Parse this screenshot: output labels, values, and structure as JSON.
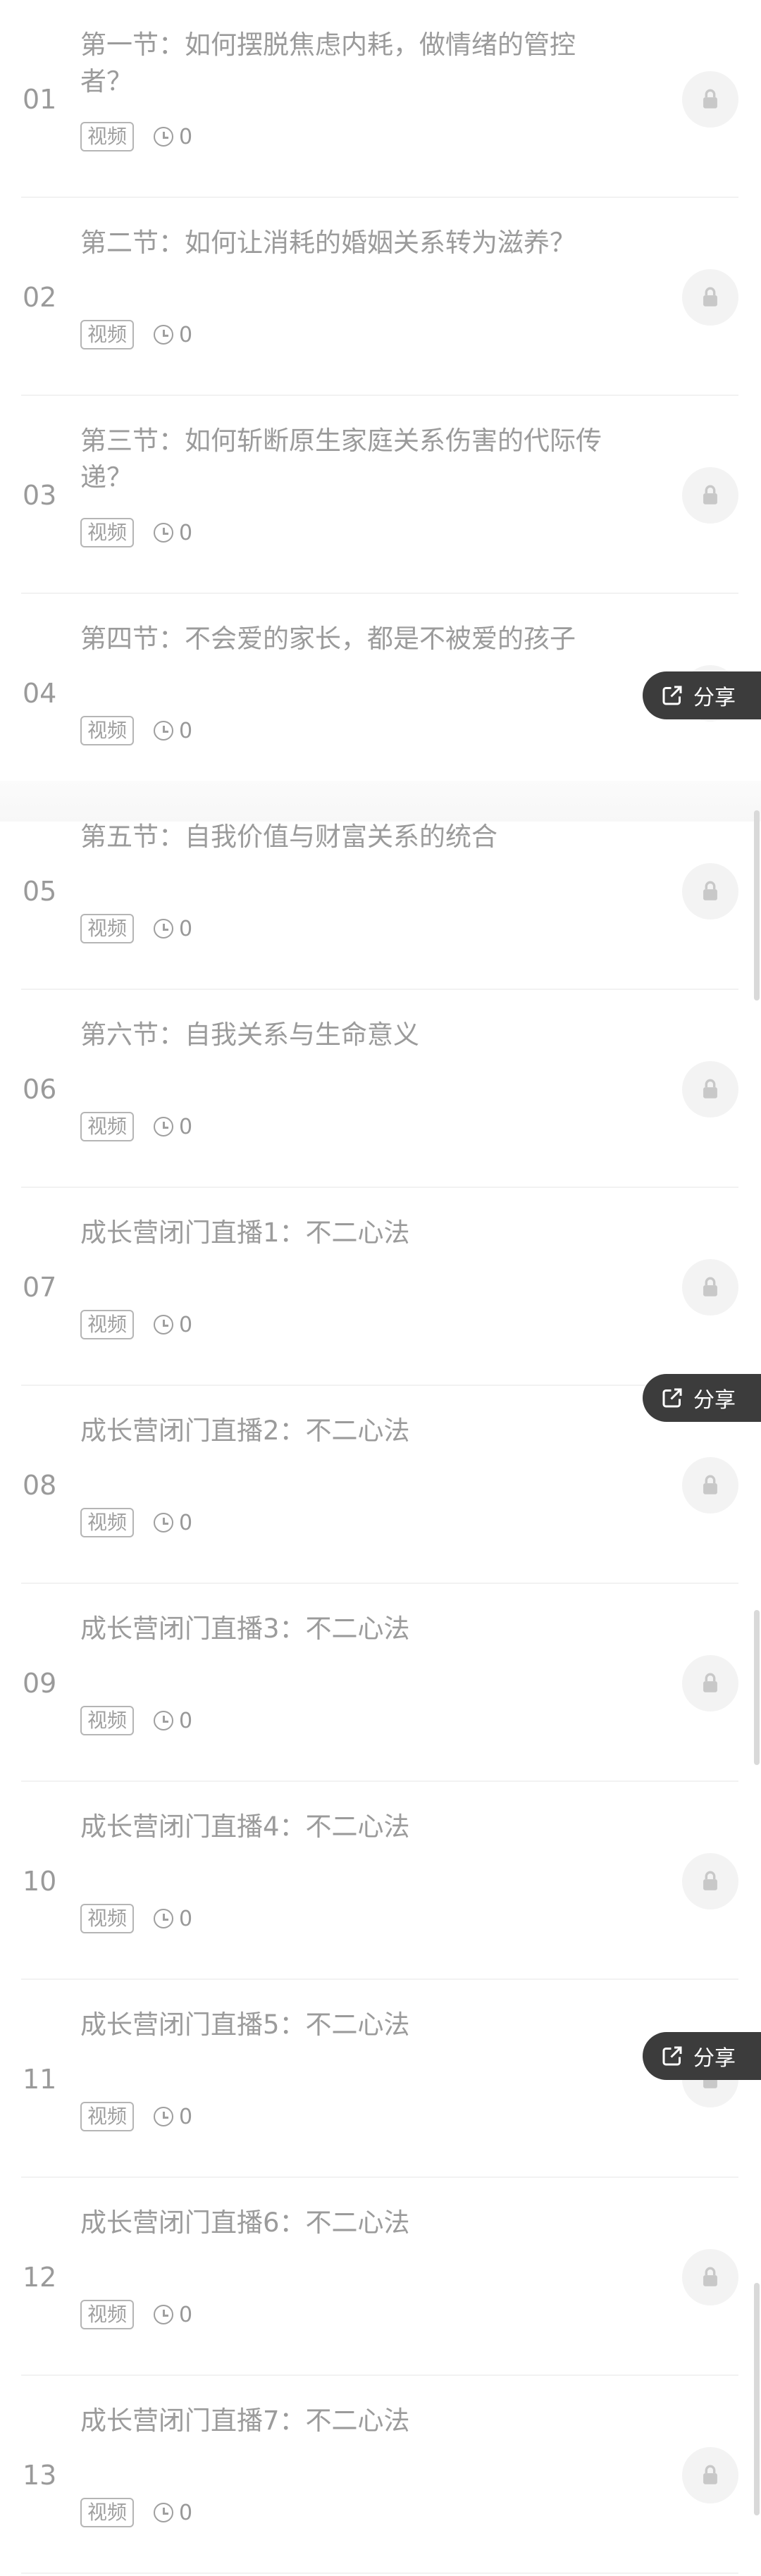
{
  "lessons": [
    {
      "num": "01",
      "title": "第一节：如何摆脱焦虑内耗，做情绪的管控者？",
      "badge": "视频",
      "views": "0"
    },
    {
      "num": "02",
      "title": "第二节：如何让消耗的婚姻关系转为滋养？",
      "badge": "视频",
      "views": "0"
    },
    {
      "num": "03",
      "title": "第三节：如何斩断原生家庭关系伤害的代际传递？",
      "badge": "视频",
      "views": "0"
    },
    {
      "num": "04",
      "title": "第四节：不会爱的家长，都是不被爱的孩子",
      "badge": "视频",
      "views": "0"
    },
    {
      "num": "05",
      "title": "第五节：自我价值与财富关系的统合",
      "badge": "视频",
      "views": "0"
    },
    {
      "num": "06",
      "title": "第六节：自我关系与生命意义",
      "badge": "视频",
      "views": "0"
    },
    {
      "num": "07",
      "title": "成长营闭门直播1：不二心法",
      "badge": "视频",
      "views": "0"
    },
    {
      "num": "08",
      "title": "成长营闭门直播2：不二心法",
      "badge": "视频",
      "views": "0"
    },
    {
      "num": "09",
      "title": "成长营闭门直播3：不二心法",
      "badge": "视频",
      "views": "0"
    },
    {
      "num": "10",
      "title": "成长营闭门直播4：不二心法",
      "badge": "视频",
      "views": "0"
    },
    {
      "num": "11",
      "title": "成长营闭门直播5：不二心法",
      "badge": "视频",
      "views": "0"
    },
    {
      "num": "12",
      "title": "成长营闭门直播6：不二心法",
      "badge": "视频",
      "views": "0"
    },
    {
      "num": "13",
      "title": "成长营闭门直播7：不二心法",
      "badge": "视频",
      "views": "0"
    }
  ],
  "share": {
    "label": "分享"
  }
}
